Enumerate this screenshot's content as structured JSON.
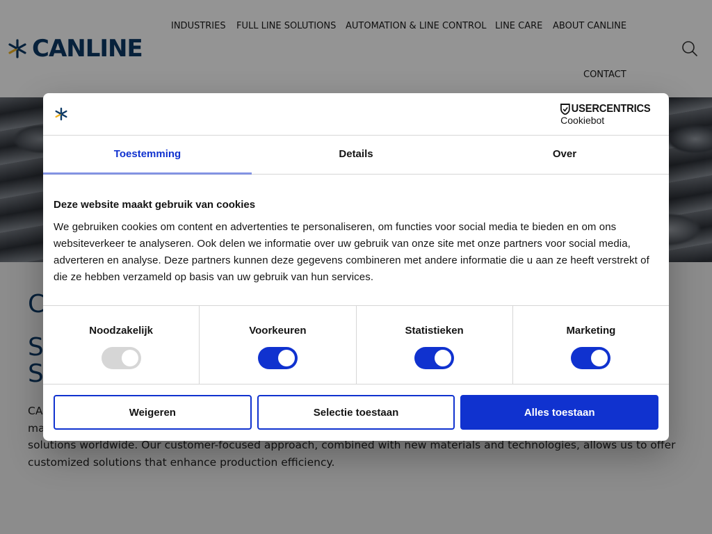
{
  "site": {
    "logo_text": "CANLINE",
    "nav": {
      "industries": "INDUSTRIES",
      "full_line": "FULL LINE SOLUTIONS",
      "automation": "AUTOMATION & LINE CONTROL",
      "line_care": "LINE CARE",
      "about": "ABOUT CANLINE",
      "contact": "CONTACT"
    },
    "content": {
      "heading_partial": "C",
      "subheading_partial_1": "S",
      "subheading_partial_2": "S",
      "paragraph_start": "CA",
      "paragraph_line2_start": "ma",
      "paragraph_line3": "solutions worldwide. Our customer-focused approach, combined with new materials and technologies, allows us to offer",
      "paragraph_line4": "customized solutions that enhance production efficiency."
    }
  },
  "cookie_dialog": {
    "brand": {
      "name": "USERCENTRICS",
      "product": "Cookiebot"
    },
    "tabs": {
      "consent": "Toestemming",
      "details": "Details",
      "about": "Over"
    },
    "title": "Deze website maakt gebruik van cookies",
    "description": "We gebruiken cookies om content en advertenties te personaliseren, om functies voor social media te bieden en om ons websiteverkeer te analyseren. Ook delen we informatie over uw gebruik van onze site met onze partners voor social media, adverteren en analyse. Deze partners kunnen deze gegevens combineren met andere informatie die u aan ze heeft verstrekt of die ze hebben verzameld op basis van uw gebruik van hun services.",
    "categories": {
      "necessary": {
        "label": "Noodzakelijk",
        "enabled": true,
        "locked": true
      },
      "preferences": {
        "label": "Voorkeuren",
        "enabled": true
      },
      "statistics": {
        "label": "Statistieken",
        "enabled": true
      },
      "marketing": {
        "label": "Marketing",
        "enabled": true
      }
    },
    "buttons": {
      "deny": "Weigeren",
      "allow_selection": "Selectie toestaan",
      "allow_all": "Alles toestaan"
    },
    "colors": {
      "accent": "#1032cf",
      "brand_dark": "#0d3a66",
      "brand_yellow": "#f0b323"
    }
  }
}
